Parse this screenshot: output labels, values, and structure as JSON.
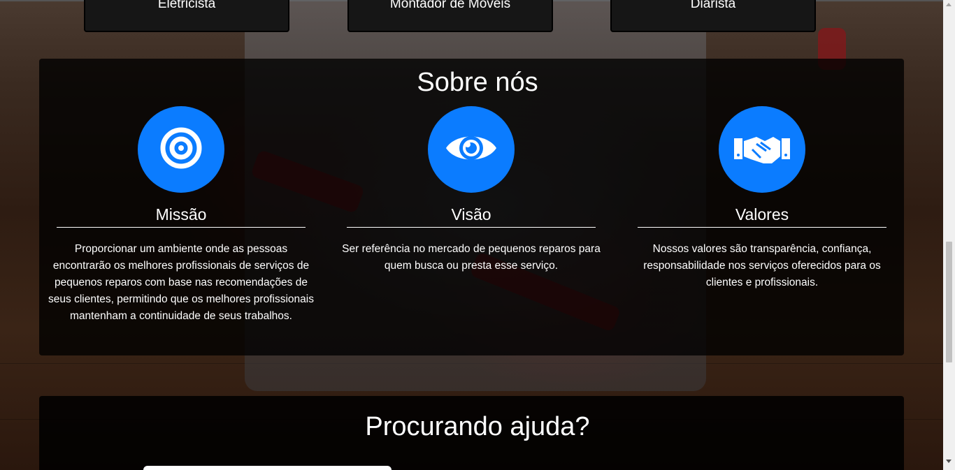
{
  "top_cards": [
    {
      "label": "Eletricista"
    },
    {
      "label": "Montador de Móveis"
    },
    {
      "label": "Diarista"
    }
  ],
  "about": {
    "title": "Sobre nós",
    "columns": [
      {
        "icon": "target-icon",
        "title": "Missão",
        "text": "Proporcionar um ambiente onde as pessoas encontrarão os melhores profissionais de serviços de pequenos reparos com base nas recomendações de seus clientes, permitindo que os melhores profissionais mantenham a continuidade de seus trabalhos."
      },
      {
        "icon": "eye-icon",
        "title": "Visão",
        "text": "Ser referência no mercado de pequenos reparos para quem busca ou presta esse serviço."
      },
      {
        "icon": "handshake-icon",
        "title": "Valores",
        "text": "Nossos valores são transparência, confiança, responsabilidade nos serviços oferecidos para os clientes e profissionais."
      }
    ]
  },
  "help": {
    "title": "Procurando ajuda?"
  },
  "colors": {
    "accent": "#0b7cff",
    "panel": "#000000"
  }
}
